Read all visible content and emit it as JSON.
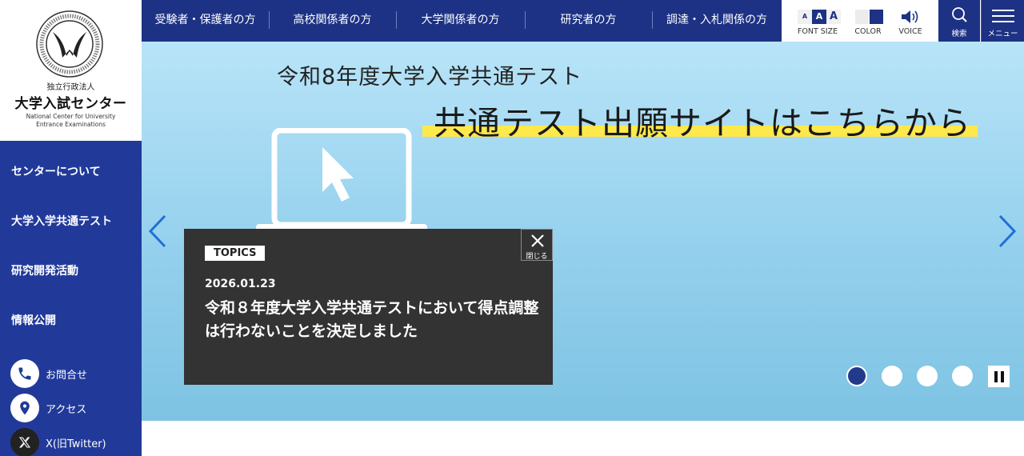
{
  "brand": {
    "org_type": "独立行政法人",
    "name": "大学入試センター",
    "name_en_line1": "National Center for University",
    "name_en_line2": "Entrance Examinations",
    "primary_color": "#213a9a"
  },
  "sidebar": {
    "nav": [
      {
        "label": "センターについて"
      },
      {
        "label": "大学入学共通テスト"
      },
      {
        "label": "研究開発活動"
      },
      {
        "label": "情報公開"
      }
    ],
    "links": [
      {
        "label": "お問合せ",
        "icon": "phone-icon"
      },
      {
        "label": "アクセス",
        "icon": "map-pin-icon"
      },
      {
        "label": "X(旧Twitter)",
        "icon": "x-logo-icon"
      }
    ]
  },
  "topnav": {
    "items": [
      {
        "label": "受験者・保護者の方"
      },
      {
        "label": "高校関係者の方"
      },
      {
        "label": "大学関係者の方"
      },
      {
        "label": "研究者の方"
      },
      {
        "label": "調達・入札関係の方"
      }
    ]
  },
  "tools": {
    "font_size_label": "FONT SIZE",
    "font_size_glyph": "A",
    "color_label": "COLOR",
    "voice_label": "VOICE",
    "search_label": "検索",
    "menu_label": "メニュー"
  },
  "hero": {
    "subtitle": "令和8年度大学入学共通テスト",
    "title": "共通テスト出願サイトはこちらから",
    "highlight_color": "#ffe84a"
  },
  "topics": {
    "badge": "TOPICS",
    "date": "2026.01.23",
    "text": "令和８年度大学入学共通テストにおいて得点調整は行わないことを決定しました",
    "close_label": "閉じる"
  },
  "carousel": {
    "slide_count": 4,
    "active_index": 0
  }
}
